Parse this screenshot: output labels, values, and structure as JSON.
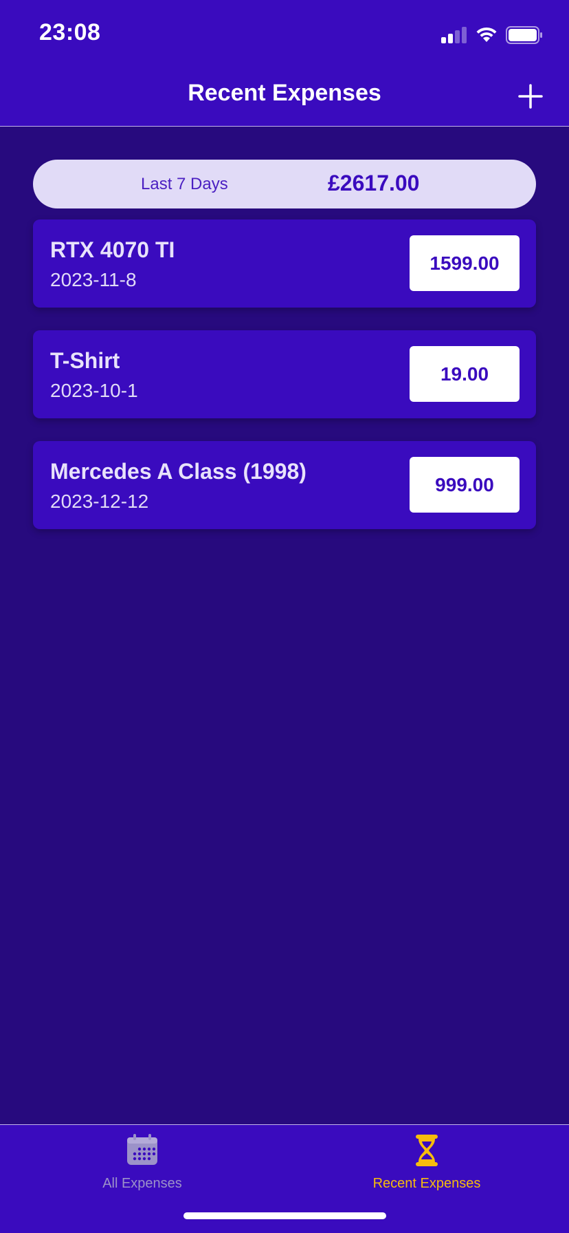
{
  "status_bar": {
    "time": "23:08"
  },
  "header": {
    "title": "Recent Expenses",
    "add_icon": "plus-icon"
  },
  "summary": {
    "period_label": "Last 7 Days",
    "total": "£2617.00"
  },
  "expenses": [
    {
      "title": "RTX 4070 TI",
      "date": "2023-11-8",
      "amount": "1599.00"
    },
    {
      "title": "T-Shirt",
      "date": "2023-10-1",
      "amount": "19.00"
    },
    {
      "title": "Mercedes A Class (1998)",
      "date": "2023-12-12",
      "amount": "999.00"
    }
  ],
  "tab_bar": {
    "tabs": [
      {
        "label": "All Expenses",
        "icon": "calendar-icon",
        "active": false
      },
      {
        "label": "Recent Expenses",
        "icon": "hourglass-icon",
        "active": true
      }
    ]
  },
  "colors": {
    "background": "#270a7e",
    "primary": "#3a0bbe",
    "summary_bg": "#e1dbf7",
    "active_tab": "#f7bc0c",
    "inactive_tab": "#9c92c9"
  }
}
